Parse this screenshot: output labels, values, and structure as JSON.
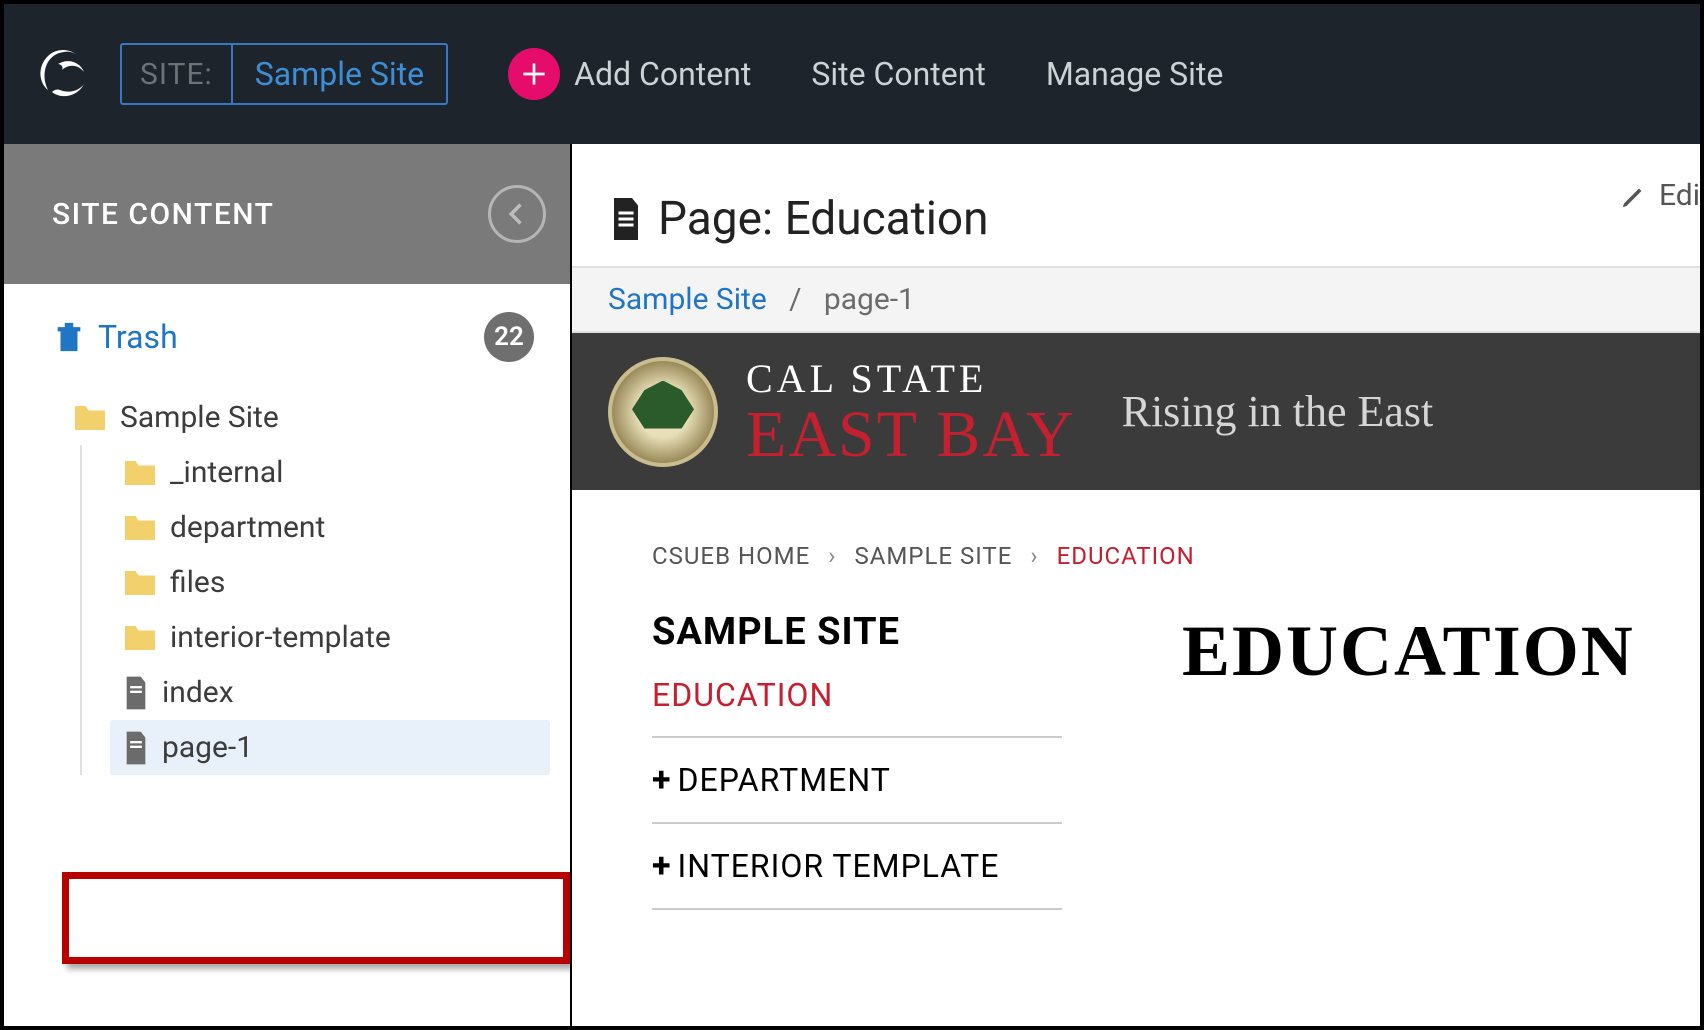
{
  "topbar": {
    "site_label": "SITE:",
    "site_value": "Sample Site",
    "add_label": "Add Content",
    "nav_site_content": "Site Content",
    "nav_manage_site": "Manage Site"
  },
  "sidebar": {
    "title": "SITE CONTENT",
    "trash_label": "Trash",
    "trash_count": "22",
    "root": "Sample Site",
    "items": [
      {
        "label": "_internal",
        "type": "folder"
      },
      {
        "label": "department",
        "type": "folder"
      },
      {
        "label": "files",
        "type": "folder"
      },
      {
        "label": "interior-template",
        "type": "folder"
      },
      {
        "label": "index",
        "type": "page"
      },
      {
        "label": "page-1",
        "type": "page",
        "selected": true
      }
    ]
  },
  "content": {
    "edit_label": "Edi",
    "page_title": "Page: Education",
    "breadcrumb_root": "Sample Site",
    "breadcrumb_sep": "/",
    "breadcrumb_current": "page-1",
    "banner": {
      "line1": "CAL STATE",
      "line2": "EAST BAY",
      "tag": "Rising in the East"
    },
    "preview_crumbs": [
      "CSUEB HOME",
      "SAMPLE SITE",
      "EDUCATION"
    ],
    "side_heading": "SAMPLE SITE",
    "side_links": [
      "EDUCATION",
      "DEPARTMENT",
      "INTERIOR TEMPLATE"
    ],
    "main_heading": "EDUCATION"
  }
}
